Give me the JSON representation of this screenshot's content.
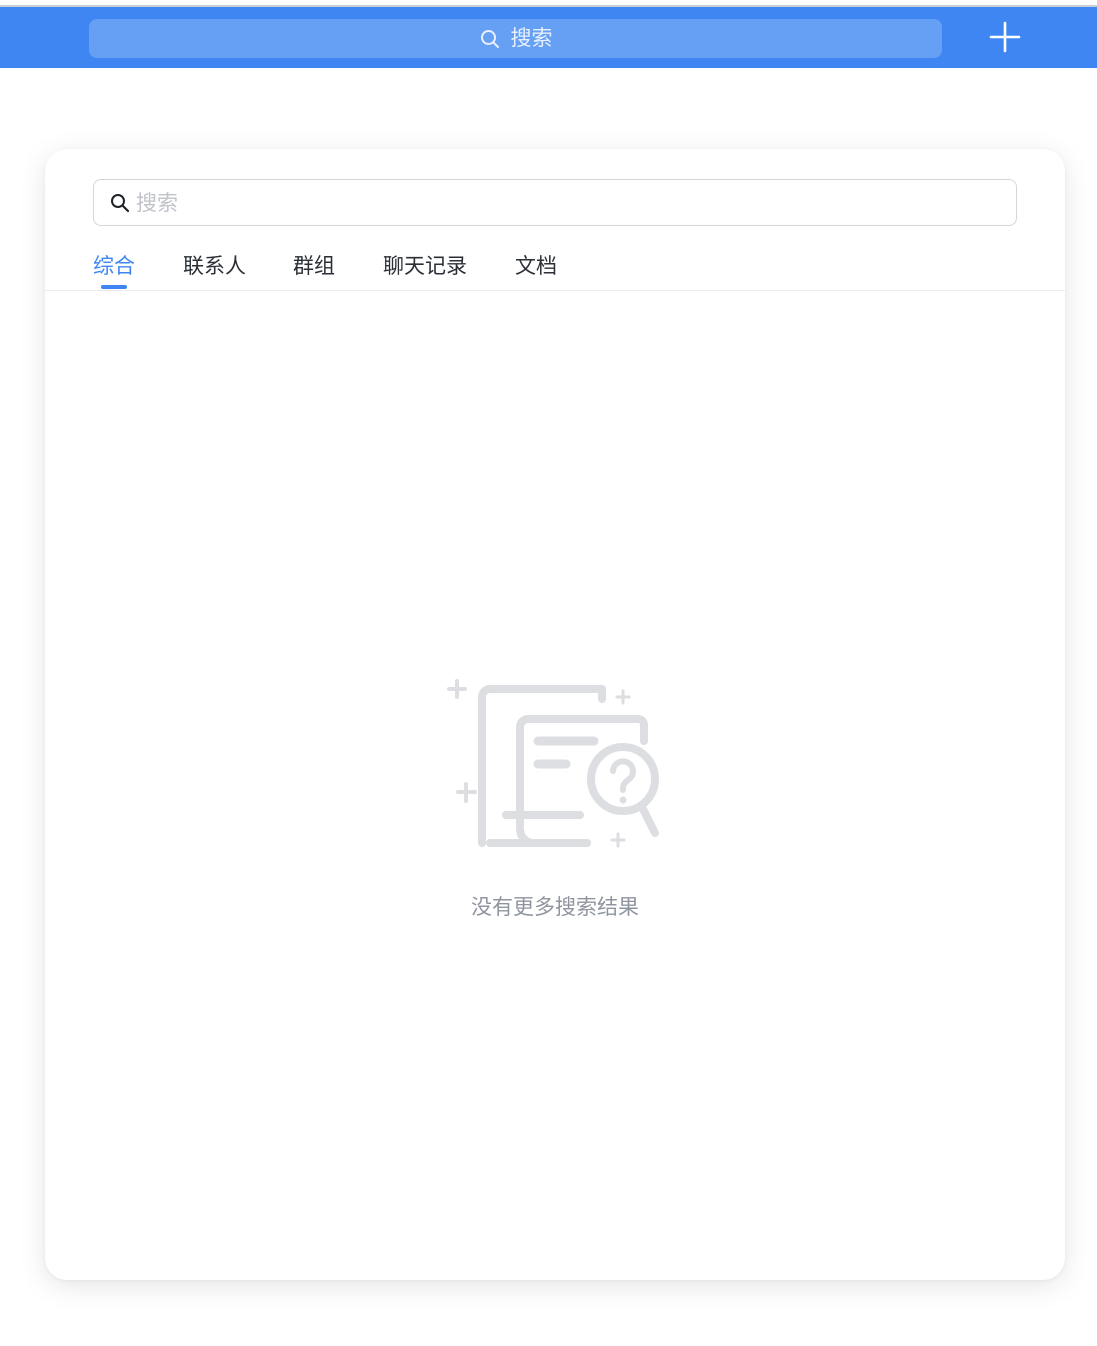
{
  "topbar": {
    "search_label": "搜索",
    "search_icon": "search-icon",
    "add_icon": "plus-icon",
    "background_color": "#3f86f2"
  },
  "search_panel": {
    "input_value": "",
    "input_placeholder": "搜索",
    "search_icon": "search-icon"
  },
  "tabs": [
    {
      "label": "综合",
      "active": true
    },
    {
      "label": "联系人",
      "active": false
    },
    {
      "label": "群组",
      "active": false
    },
    {
      "label": "聊天记录",
      "active": false
    },
    {
      "label": "文档",
      "active": false
    }
  ],
  "empty_state": {
    "icon": "document-search-question-icon",
    "message": "没有更多搜索结果"
  },
  "colors": {
    "accent": "#3f86f2",
    "tab_text": "#2b2f36",
    "empty_text": "#8f959e",
    "illustration": "#dcdee2"
  }
}
